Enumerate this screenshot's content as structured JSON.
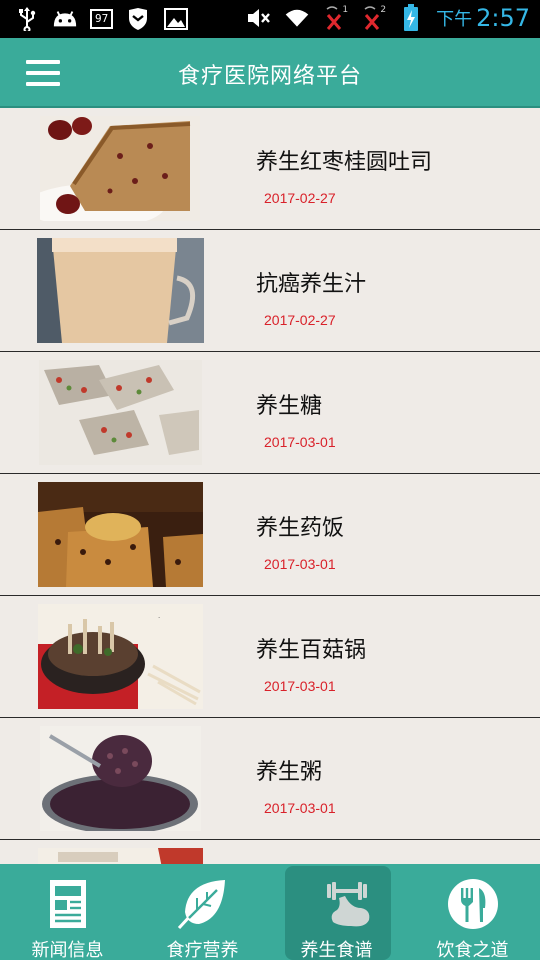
{
  "status_bar": {
    "battery_level": "97",
    "time_prefix": "下午",
    "time": "2:57",
    "left_icons": [
      "usb-icon",
      "android-icon",
      "battery-percent-icon",
      "shield-icon",
      "image-icon"
    ],
    "right_icons": [
      "mute-icon",
      "wifi-icon",
      "signal-1-icon",
      "signal-2-icon",
      "battery-charging-icon"
    ],
    "sim1_label": "1",
    "sim2_label": "2",
    "clock_color": "#35b7e6"
  },
  "app_bar": {
    "title": "食疗医院网络平台",
    "menu_icon": "hamburger-menu-icon",
    "color": "#3aab9a"
  },
  "recipes": [
    {
      "title": "养生红枣桂圆吐司",
      "date": "2017-02-27"
    },
    {
      "title": "抗癌养生汁",
      "date": "2017-02-27"
    },
    {
      "title": "养生糖",
      "date": "2017-03-01"
    },
    {
      "title": "养生药饭",
      "date": "2017-03-01"
    },
    {
      "title": "养生百菇锅",
      "date": "2017-03-01"
    },
    {
      "title": "养生粥",
      "date": "2017-03-01"
    }
  ],
  "bottom_nav": [
    {
      "label": "新闻信息",
      "icon": "newspaper-icon",
      "active": false
    },
    {
      "label": "食疗营养",
      "icon": "leaf-icon",
      "active": false
    },
    {
      "label": "养生食谱",
      "icon": "muscle-icon",
      "active": true
    },
    {
      "label": "饮食之道",
      "icon": "fork-knife-icon",
      "active": false
    }
  ],
  "colors": {
    "accent": "#3aab9a",
    "accent_dark": "#2b8f80",
    "date": "#d9212a",
    "background": "#efebe7"
  }
}
